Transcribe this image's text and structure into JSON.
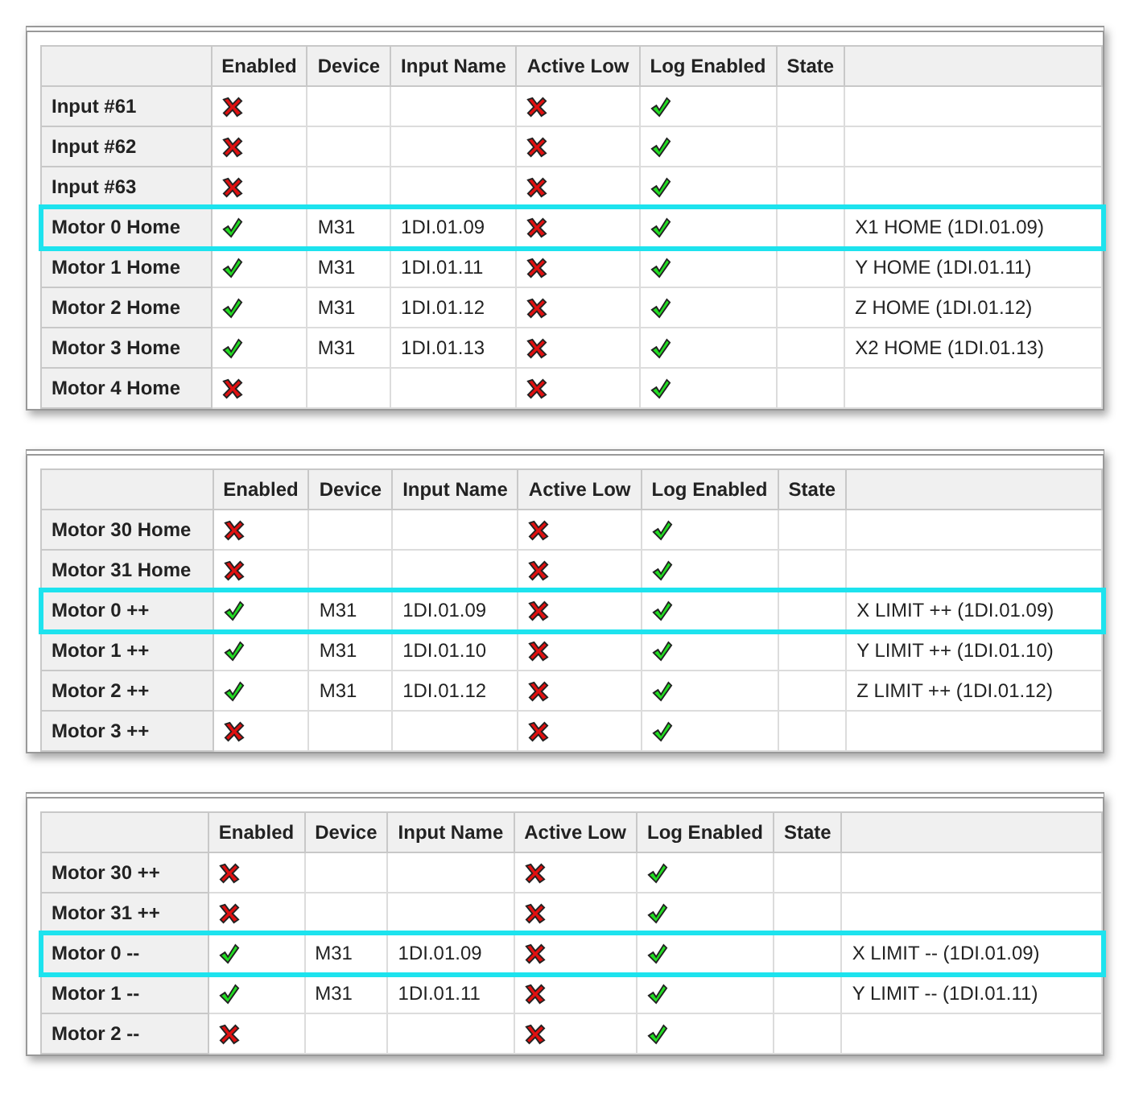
{
  "panels": [
    {
      "columns": [
        "Enabled",
        "Device",
        "Input Name",
        "Active Low",
        "Log Enabled",
        "State"
      ],
      "rows": [
        {
          "label": "Input #61",
          "enabled": false,
          "active_low": false,
          "log_enabled": true,
          "highlighted": false
        },
        {
          "label": "Input #62",
          "enabled": false,
          "active_low": false,
          "log_enabled": true,
          "highlighted": false
        },
        {
          "label": "Input #63",
          "enabled": false,
          "active_low": false,
          "log_enabled": true,
          "highlighted": false
        },
        {
          "label": "Motor 0 Home",
          "enabled": true,
          "device": "M31",
          "input_name": "1DI.01.09",
          "active_low": false,
          "log_enabled": true,
          "column_8": "X1 HOME (1DI.01.09)",
          "highlighted": true
        },
        {
          "label": "Motor 1 Home",
          "enabled": true,
          "device": "M31",
          "input_name": "1DI.01.11",
          "active_low": false,
          "log_enabled": true,
          "column_8": "Y HOME (1DI.01.11)",
          "highlighted": false
        },
        {
          "label": "Motor 2 Home",
          "enabled": true,
          "device": "M31",
          "input_name": "1DI.01.12",
          "active_low": false,
          "log_enabled": true,
          "column_8": "Z  HOME (1DI.01.12)",
          "highlighted": false
        },
        {
          "label": "Motor 3 Home",
          "enabled": true,
          "device": "M31",
          "input_name": "1DI.01.13",
          "active_low": false,
          "log_enabled": true,
          "column_8": "X2 HOME (1DI.01.13)",
          "highlighted": false
        },
        {
          "label": "Motor 4 Home",
          "enabled": false,
          "active_low": false,
          "log_enabled": true,
          "highlighted": false
        }
      ]
    },
    {
      "columns": [
        "Enabled",
        "Device",
        "Input Name",
        "Active Low",
        "Log Enabled",
        "State"
      ],
      "rows": [
        {
          "label": "Motor 30 Home",
          "enabled": false,
          "active_low": false,
          "log_enabled": true,
          "highlighted": false
        },
        {
          "label": "Motor 31 Home",
          "enabled": false,
          "active_low": false,
          "log_enabled": true,
          "highlighted": false
        },
        {
          "label": "Motor 0 ++",
          "enabled": true,
          "device": "M31",
          "input_name": "1DI.01.09",
          "active_low": false,
          "log_enabled": true,
          "column_8": "X LIMIT ++ (1DI.01.09)",
          "highlighted": true
        },
        {
          "label": "Motor 1 ++",
          "enabled": true,
          "device": "M31",
          "input_name": "1DI.01.10",
          "active_low": false,
          "log_enabled": true,
          "column_8": "Y LIMIT ++ (1DI.01.10)",
          "highlighted": false
        },
        {
          "label": "Motor 2 ++",
          "enabled": true,
          "device": "M31",
          "input_name": "1DI.01.12",
          "active_low": false,
          "log_enabled": true,
          "column_8": "Z LIMIT ++ (1DI.01.12)",
          "highlighted": false
        },
        {
          "label": "Motor 3 ++",
          "enabled": false,
          "active_low": false,
          "log_enabled": true,
          "highlighted": false
        }
      ]
    },
    {
      "columns": [
        "Enabled",
        "Device",
        "Input Name",
        "Active Low",
        "Log Enabled",
        "State"
      ],
      "rows": [
        {
          "label": "Motor 30 ++",
          "enabled": false,
          "active_low": false,
          "log_enabled": true,
          "highlighted": false
        },
        {
          "label": "Motor 31 ++",
          "enabled": false,
          "active_low": false,
          "log_enabled": true,
          "highlighted": false
        },
        {
          "label": "Motor 0 --",
          "enabled": true,
          "device": "M31",
          "input_name": "1DI.01.09",
          "active_low": false,
          "log_enabled": true,
          "column_8": "X LIMIT -- (1DI.01.09)",
          "highlighted": true
        },
        {
          "label": "Motor 1 --",
          "enabled": true,
          "device": "M31",
          "input_name": "1DI.01.11",
          "active_low": false,
          "log_enabled": true,
          "column_8": "Y LIMIT -- (1DI.01.11)",
          "highlighted": false
        },
        {
          "label": "Motor 2 --",
          "enabled": false,
          "active_low": false,
          "log_enabled": true,
          "highlighted": false
        }
      ]
    }
  ]
}
